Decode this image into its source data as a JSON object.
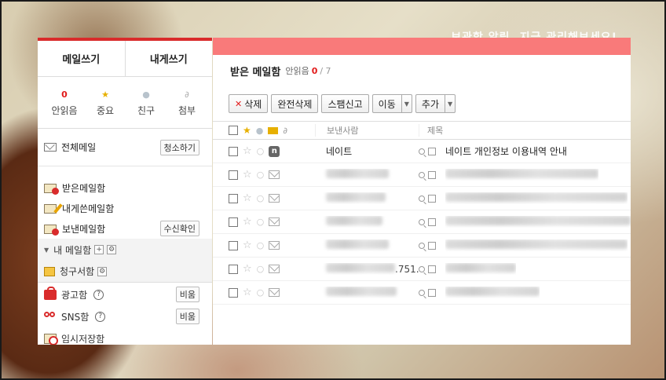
{
  "bg_text": "보관함 알림, 지금 관리해보세요!",
  "sidebar": {
    "write_mail": "메일쓰기",
    "write_self": "내게쓰기",
    "counters": [
      {
        "top": "0",
        "label": "안읽음",
        "icon": "count"
      },
      {
        "top": "★",
        "label": "중요",
        "icon": "star-icon"
      },
      {
        "top": "👤",
        "label": "친구",
        "icon": "person-icon"
      },
      {
        "top": "📎",
        "label": "첨부",
        "icon": "paperclip-icon"
      }
    ],
    "all_mail": "전체메일",
    "clean_up": "청소하기",
    "folders": [
      {
        "label": "받은메일함"
      },
      {
        "label": "내게쓴메일함"
      },
      {
        "label": "보낸메일함",
        "action": "수신확인"
      }
    ],
    "my_mailbox": "내 메일함",
    "bills": "청구서함",
    "ads": "광고함",
    "sns": "SNS함",
    "empty": "비움",
    "drafts": "임시저장함"
  },
  "main": {
    "title": "받은 메일함",
    "unread_label": "안읽음",
    "unread_count": "0",
    "total": "/ 7",
    "toolbar": {
      "delete": "삭제",
      "perm_delete": "완전삭제",
      "spam": "스팸신고",
      "move": "이동",
      "add": "추가"
    },
    "columns": {
      "sender": "보낸사람",
      "subject": "제목"
    },
    "rows": [
      {
        "sender": "네이트",
        "subject": "네이트 개인정보 이용내역 안내",
        "sender_blur": false,
        "subject_blur": false,
        "badge": "n"
      },
      {
        "sender": "",
        "subject": "",
        "sender_blur": true,
        "subject_blur": true
      },
      {
        "sender": "",
        "subject": "",
        "sender_blur": true,
        "subject_blur": true
      },
      {
        "sender": "",
        "subject": "",
        "sender_blur": true,
        "subject_blur": true
      },
      {
        "sender": "",
        "subject": "",
        "sender_blur": true,
        "subject_blur": true
      },
      {
        "sender": ".751...",
        "subject": "",
        "sender_blur": true,
        "subject_blur": true
      },
      {
        "sender": "",
        "subject": "",
        "sender_blur": true,
        "subject_blur": true
      }
    ]
  }
}
